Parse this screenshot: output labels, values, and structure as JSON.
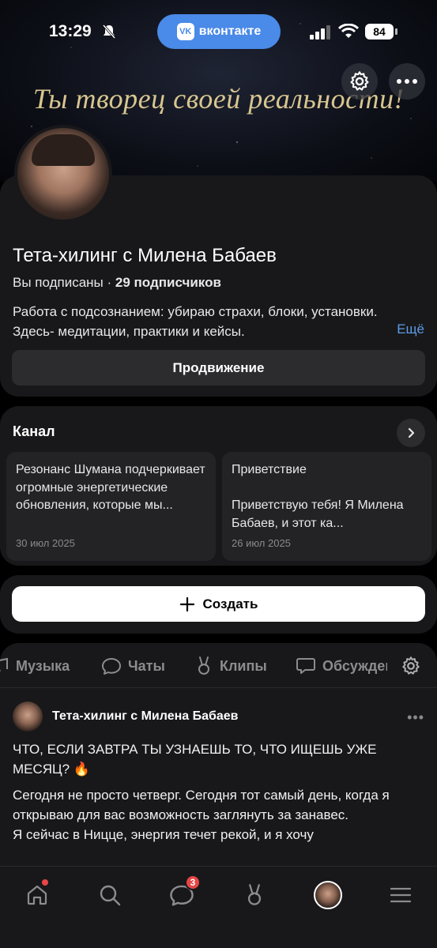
{
  "status_bar": {
    "time": "13:29",
    "battery": "84",
    "app_pill": "вконтакте"
  },
  "cover": {
    "quote": "Ты творец своей реальности!"
  },
  "profile": {
    "name": "Тета-хилинг с Милена Бабаев",
    "subscribed": "Вы подписаны",
    "separator": "·",
    "subscribers": "29 подписчиков",
    "description": "Работа с подсознанием: убираю страхи, блоки, установки. Здесь- медитации, практики и кейсы.",
    "more": "Ещё",
    "promo_button": "Продвижение"
  },
  "channel": {
    "title": "Канал",
    "posts": [
      {
        "text": "Резонанс Шумана подчеркивает огромные энергетические обновления, которые мы...",
        "date": "30 июл 2025"
      },
      {
        "text": "Приветствие\n\nПриветствую тебя! Я Милена Бабаев, и этот ка...",
        "date": "26 июл 2025"
      }
    ]
  },
  "create": {
    "label": "Создать"
  },
  "tabs": [
    {
      "label": "Музыка",
      "icon": "music-icon"
    },
    {
      "label": "Чаты",
      "icon": "chat-icon"
    },
    {
      "label": "Клипы",
      "icon": "clips-icon"
    },
    {
      "label": "Обсуждения",
      "icon": "discussion-icon"
    }
  ],
  "post": {
    "author": "Тета-хилинг с Милена Бабаев",
    "headline": "ЧТО, ЕСЛИ ЗАВТРА ТЫ УЗНАЕШЬ ТО, ЧТО ИЩЕШЬ УЖЕ МЕСЯЦ? 🔥",
    "paragraph1": "Сегодня не просто четверг. Сегодня тот самый день, когда я открываю для вас возможность заглянуть за занавес.",
    "paragraph2": "Я сейчас в Ницце, энергия течет рекой, и я хочу"
  },
  "bottom_nav": {
    "messages_badge": "3"
  },
  "colors": {
    "accent": "#4a8ae8",
    "link": "#5c9ce6",
    "badge": "#e64646",
    "quote": "#d8c690"
  }
}
